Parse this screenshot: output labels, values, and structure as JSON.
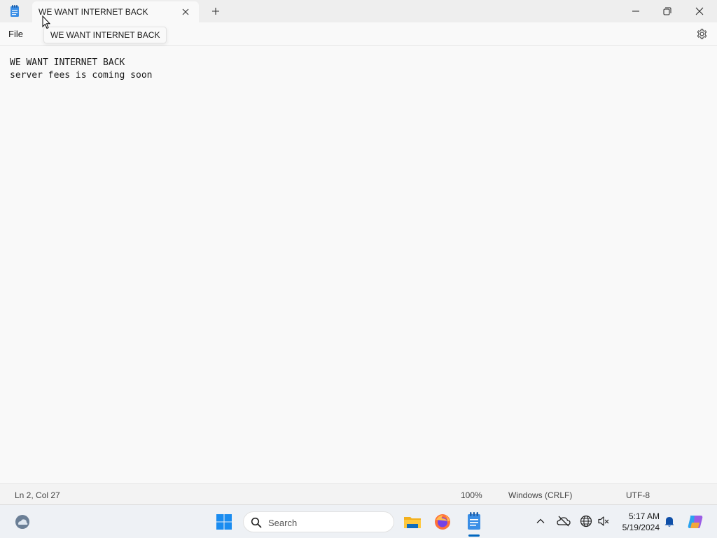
{
  "window": {
    "tab_title": "WE WANT INTERNET BACK",
    "tooltip": "WE WANT INTERNET BACK",
    "icons": [
      "notepad-icon",
      "close-icon",
      "plus-icon",
      "minimize-icon",
      "restore-icon",
      "close-icon"
    ]
  },
  "menu": {
    "file_label": "File",
    "settings_icon": "gear-icon"
  },
  "editor": {
    "lines": [
      "WE WANT INTERNET BACK",
      "server fees is coming soon"
    ]
  },
  "status": {
    "position": "Ln 2, Col 27",
    "zoom": "100%",
    "line_ending": "Windows (CRLF)",
    "encoding": "UTF-8"
  },
  "taskbar": {
    "search_label": "Search",
    "time": "5:17 AM",
    "date": "5/19/2024",
    "apps": [
      "start-icon",
      "file-explorer-icon",
      "firefox-icon",
      "notepad-icon"
    ],
    "tray": [
      "chevron-up-icon",
      "cloud-off-icon",
      "network-icon",
      "volume-icon",
      "bell-icon",
      "copilot-icon"
    ]
  },
  "colors": {
    "accent": "#0067c0",
    "background": "#f9f9f9",
    "titlebar": "#eeeeee",
    "taskbar": "#eef1f5"
  }
}
